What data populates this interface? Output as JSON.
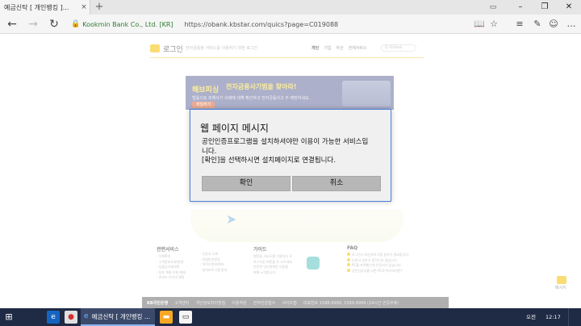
{
  "browser": {
    "tab_title": "예금신탁 [ 개인뱅킹 ]...",
    "tab_close": "×",
    "new_tab": "+",
    "site_identity": "Kookmin Bank Co., Ltd. [KR]",
    "url": "https://obank.kbstar.com/quics?page=C019088",
    "icons": [
      "back-icon",
      "forward-icon",
      "refresh-icon",
      "reading-view-icon",
      "favorite-icon",
      "hub-icon",
      "note-icon",
      "feedback-icon",
      "more-icon"
    ]
  },
  "page": {
    "header_title": "로그인",
    "header_subtitle": "전자금융을 서비스를 이용하기 위한 로그인",
    "menu": [
      "개인",
      "기업",
      "자산",
      "전체서비스"
    ],
    "search_placeholder": "Q Global",
    "banner": {
      "logo": "해브피싱",
      "title": "전자금융사기범을 찾아라!",
      "desc": "법률으로 피해사기 사례에 대해 확인하고 전자금융사고 두 예방하세요.",
      "button": "게임하기"
    },
    "footer_columns": [
      {
        "title": "관련서비스",
        "items": [
          "· 이체확인",
          "· 고객정보조회/변경",
          "· 입출금거래내역",
          "· 보호 계좌 조회 해제",
          "· 로비즈 인터넷 뱅킹"
        ]
      },
      {
        "title": "",
        "items": [
          "· 인증서 조회",
          "· 비밀번호변경",
          "· 아이디변경/해지",
          "· 설치프로그램 관리"
        ]
      },
      {
        "title": "가이드",
        "items": [
          "뱅킹을 서비스를 이용하신 후",
          "로그아웃 버튼을 꼭 누르세요.",
          "안전한 인터넷뱅킹 이용을",
          "위해 노력합니다."
        ]
      },
      {
        "title": "FAQ",
        "items": [
          "로그인시 보안프로그램 설치가 필요합니다.",
          "인증서 암호가 생각나지 않습니다.",
          "PC를 포맷했는데 인증서가 없습니다.",
          "공인인증서를 다른 PC로 복사하려면?"
        ]
      }
    ],
    "footer_bar": [
      "KB국민은행",
      "고객센터",
      "개인정보처리방침",
      "이용약관",
      "전자민원접수",
      "사이트맵",
      "대표번호 1588-9999, 1599-9999 (24시간 연중무휴)"
    ],
    "message_label": "메시지"
  },
  "dialog": {
    "title": "웹 페이지 메시지",
    "message_lines": [
      "공인인증프로그램을 설치하셔야만 이용이 가능한 서비스입",
      "니다.",
      "[확인]을 선택하시면 설치페이지로 연결됩니다."
    ],
    "ok_label": "확인",
    "cancel_label": "취소"
  },
  "taskbar": {
    "active_window": "예금신탁 [ 개인뱅킹 ...",
    "tray_text": "오전",
    "time": "12:17"
  },
  "colors": {
    "dialog_border": "#4f7fd6",
    "dialog_button": "#b7b7b7",
    "taskbar": "#1f2a44",
    "secure_green": "#2e7d32",
    "kb_yellow": "#f5c000"
  }
}
